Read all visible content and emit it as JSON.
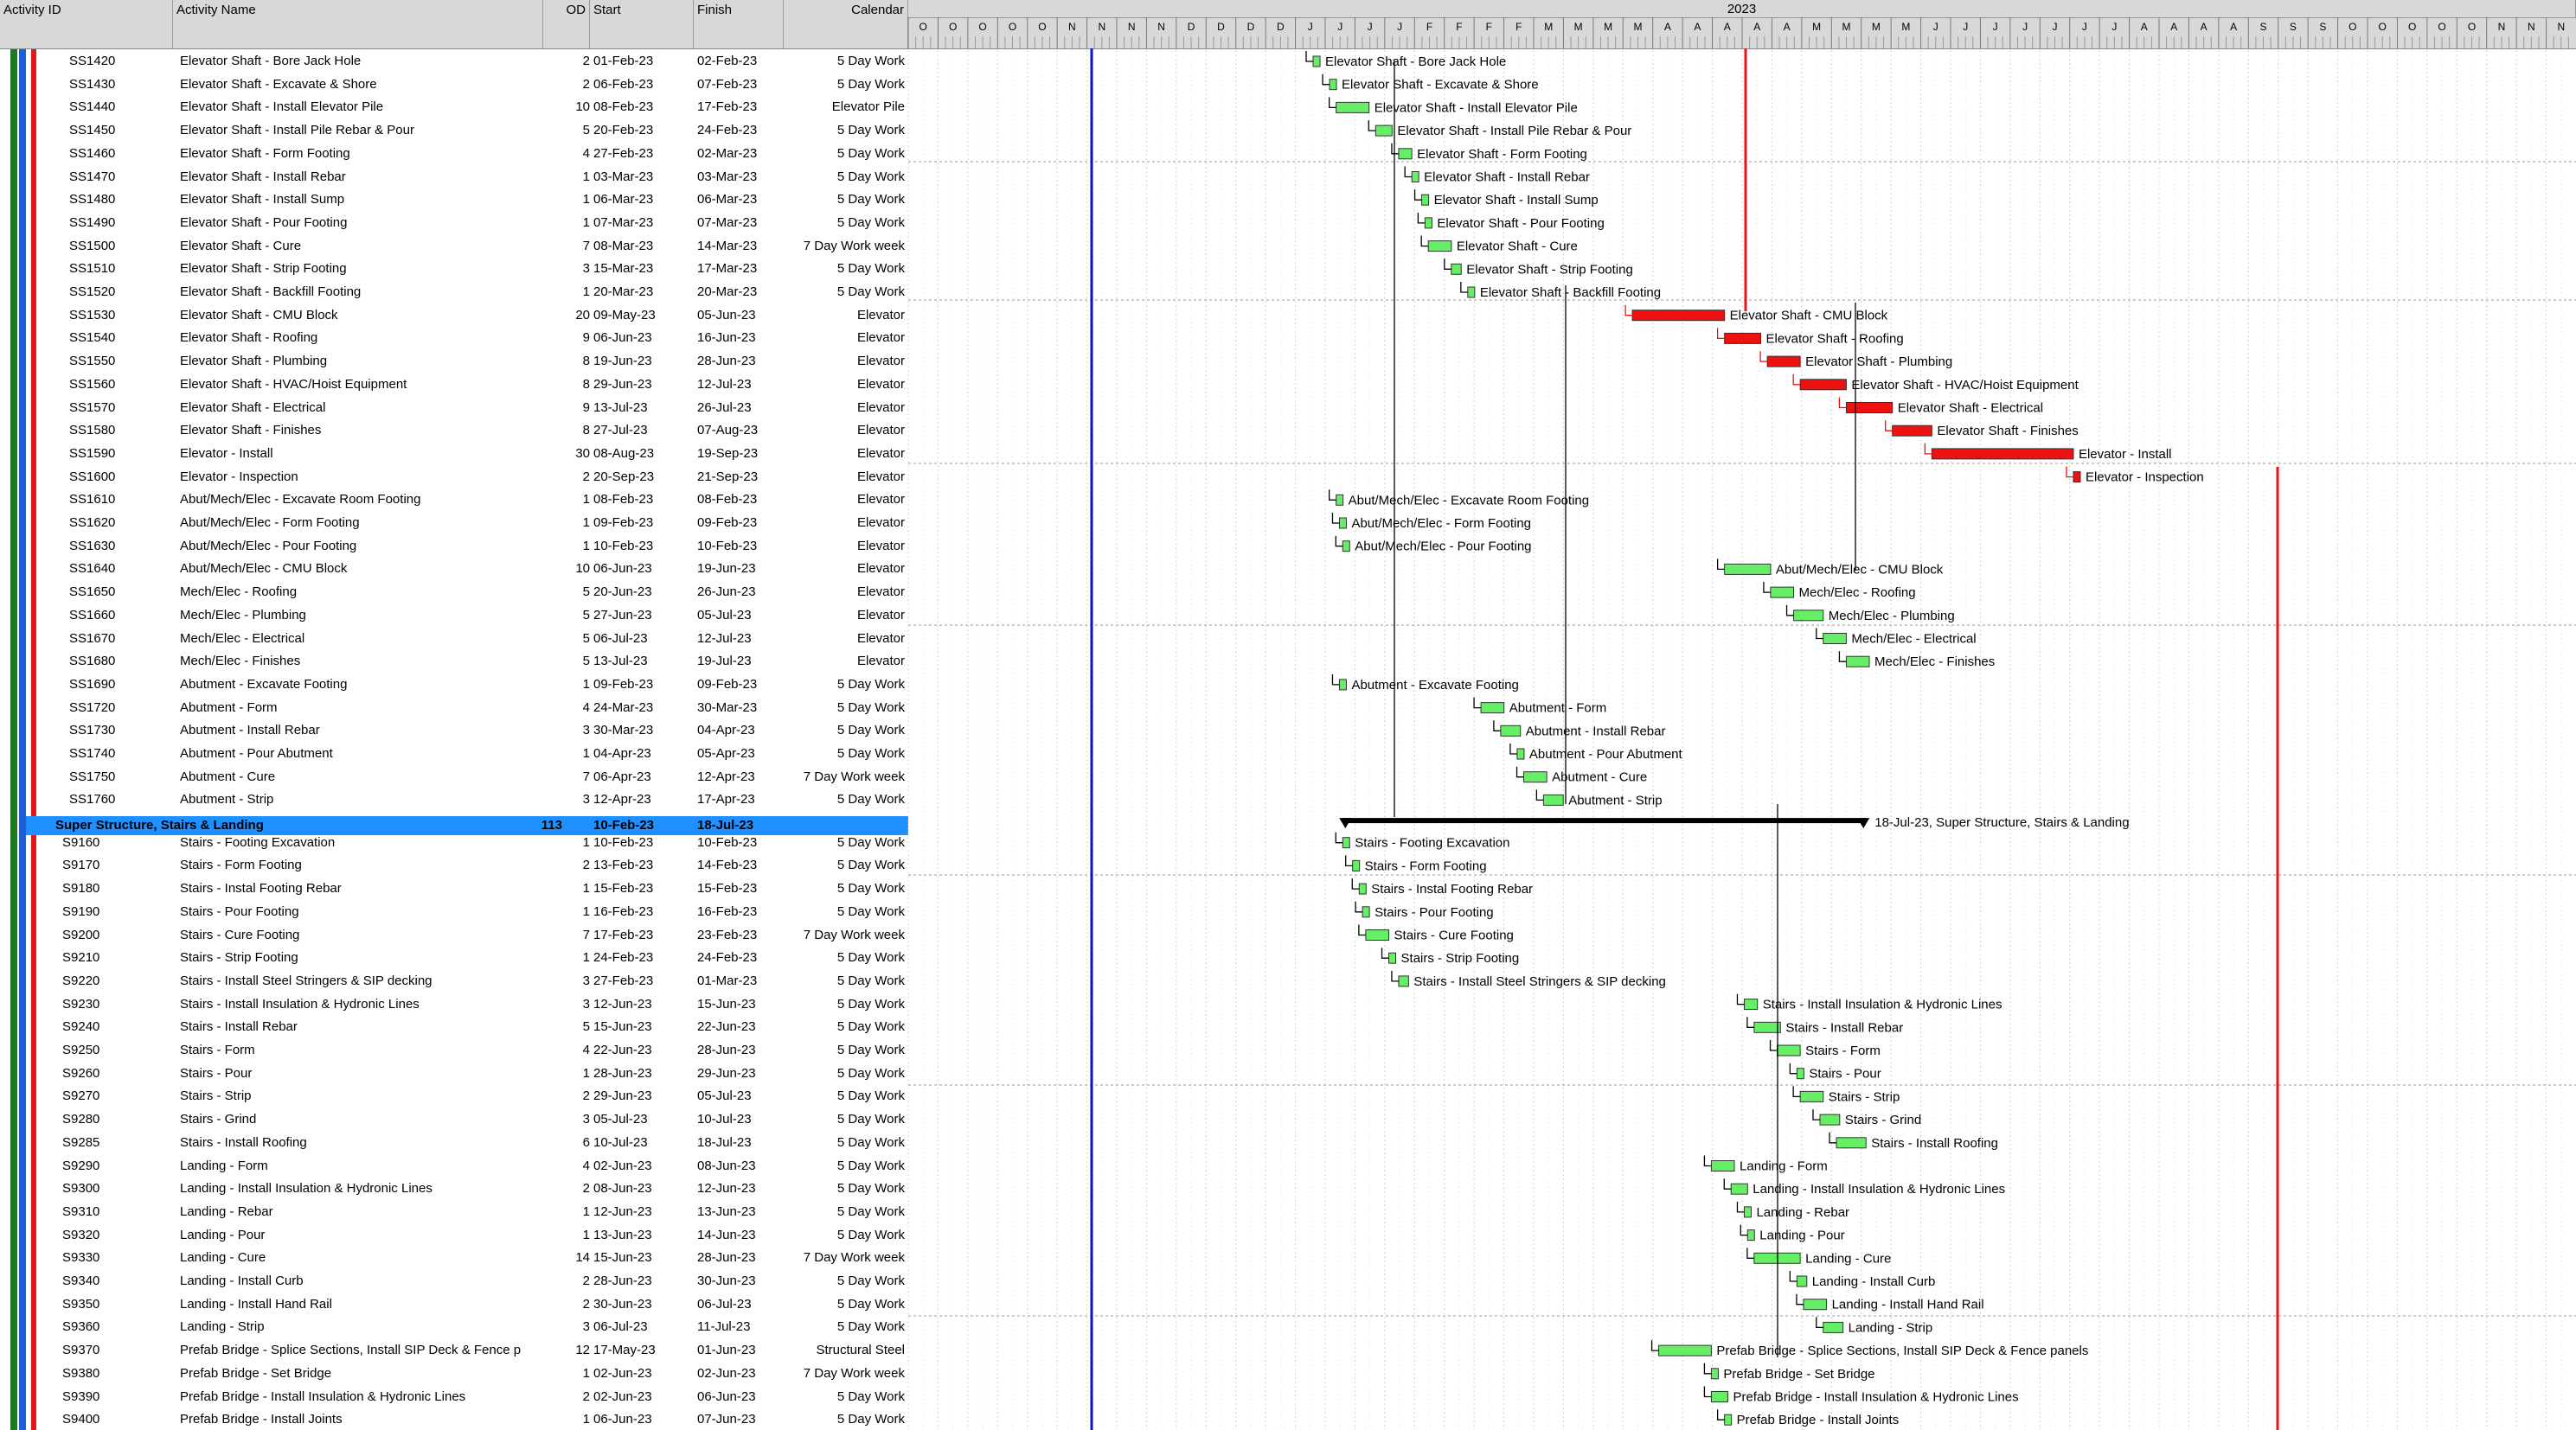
{
  "columns": {
    "id": "Activity ID",
    "name": "Activity Name",
    "od": "OD",
    "start": "Start",
    "finish": "Finish",
    "calendar": "Calendar"
  },
  "timeline": {
    "year": "2023",
    "months": [
      "O",
      "O",
      "O",
      "O",
      "O",
      "N",
      "N",
      "N",
      "N",
      "D",
      "D",
      "D",
      "D",
      "J",
      "J",
      "J",
      "J",
      "F",
      "F",
      "F",
      "F",
      "M",
      "M",
      "M",
      "M",
      "A",
      "A",
      "A",
      "A",
      "A",
      "M",
      "M",
      "M",
      "M",
      "J",
      "J",
      "J",
      "J",
      "J",
      "J",
      "J",
      "A",
      "A",
      "A",
      "A",
      "S",
      "S",
      "S",
      "O",
      "O",
      "O",
      "O",
      "O",
      "N",
      "N",
      "N"
    ]
  },
  "wbs": {
    "name": "Super Structure, Stairs & Landing",
    "od": "113",
    "start": "10-Feb-23",
    "finish": "18-Jul-23",
    "bar_label": "18-Jul-23, Super Structure, Stairs & Landing"
  },
  "colors": {
    "selected": "#1e90ff",
    "critical": "#ee1111",
    "normal": "#66ee66",
    "data_date": "#1010cc",
    "header": "#d8d8d8"
  },
  "activities": [
    {
      "id": "SS1420",
      "name": "Elevator Shaft - Bore Jack Hole",
      "od": "2",
      "start": "01-Feb-23",
      "finish": "02-Feb-23",
      "cal": "5 Day Work"
    },
    {
      "id": "SS1430",
      "name": "Elevator Shaft - Excavate & Shore",
      "od": "2",
      "start": "06-Feb-23",
      "finish": "07-Feb-23",
      "cal": "5 Day Work"
    },
    {
      "id": "SS1440",
      "name": "Elevator Shaft - Install Elevator Pile",
      "od": "10",
      "start": "08-Feb-23",
      "finish": "17-Feb-23",
      "cal": "Elevator Pile"
    },
    {
      "id": "SS1450",
      "name": "Elevator Shaft - Install Pile Rebar & Pour",
      "od": "5",
      "start": "20-Feb-23",
      "finish": "24-Feb-23",
      "cal": "5 Day Work"
    },
    {
      "id": "SS1460",
      "name": "Elevator Shaft - Form Footing",
      "od": "4",
      "start": "27-Feb-23",
      "finish": "02-Mar-23",
      "cal": "5 Day Work"
    },
    {
      "id": "SS1470",
      "name": "Elevator Shaft - Install Rebar",
      "od": "1",
      "start": "03-Mar-23",
      "finish": "03-Mar-23",
      "cal": "5 Day Work"
    },
    {
      "id": "SS1480",
      "name": "Elevator Shaft - Install Sump",
      "od": "1",
      "start": "06-Mar-23",
      "finish": "06-Mar-23",
      "cal": "5 Day Work"
    },
    {
      "id": "SS1490",
      "name": "Elevator Shaft - Pour Footing",
      "od": "1",
      "start": "07-Mar-23",
      "finish": "07-Mar-23",
      "cal": "5 Day Work"
    },
    {
      "id": "SS1500",
      "name": "Elevator Shaft - Cure",
      "od": "7",
      "start": "08-Mar-23",
      "finish": "14-Mar-23",
      "cal": "7 Day Work week"
    },
    {
      "id": "SS1510",
      "name": "Elevator Shaft - Strip Footing",
      "od": "3",
      "start": "15-Mar-23",
      "finish": "17-Mar-23",
      "cal": "5 Day Work"
    },
    {
      "id": "SS1520",
      "name": "Elevator Shaft - Backfill Footing",
      "od": "1",
      "start": "20-Mar-23",
      "finish": "20-Mar-23",
      "cal": "5 Day Work"
    },
    {
      "id": "SS1530",
      "name": "Elevator Shaft - CMU Block",
      "od": "20",
      "start": "09-May-23",
      "finish": "05-Jun-23",
      "cal": "Elevator"
    },
    {
      "id": "SS1540",
      "name": "Elevator Shaft - Roofing",
      "od": "9",
      "start": "06-Jun-23",
      "finish": "16-Jun-23",
      "cal": "Elevator"
    },
    {
      "id": "SS1550",
      "name": "Elevator Shaft - Plumbing",
      "od": "8",
      "start": "19-Jun-23",
      "finish": "28-Jun-23",
      "cal": "Elevator"
    },
    {
      "id": "SS1560",
      "name": "Elevator Shaft - HVAC/Hoist Equipment",
      "od": "8",
      "start": "29-Jun-23",
      "finish": "12-Jul-23",
      "cal": "Elevator"
    },
    {
      "id": "SS1570",
      "name": "Elevator Shaft - Electrical",
      "od": "9",
      "start": "13-Jul-23",
      "finish": "26-Jul-23",
      "cal": "Elevator"
    },
    {
      "id": "SS1580",
      "name": "Elevator Shaft - Finishes",
      "od": "8",
      "start": "27-Jul-23",
      "finish": "07-Aug-23",
      "cal": "Elevator"
    },
    {
      "id": "SS1590",
      "name": "Elevator - Install",
      "od": "30",
      "start": "08-Aug-23",
      "finish": "19-Sep-23",
      "cal": "Elevator"
    },
    {
      "id": "SS1600",
      "name": "Elevator - Inspection",
      "od": "2",
      "start": "20-Sep-23",
      "finish": "21-Sep-23",
      "cal": "Elevator"
    },
    {
      "id": "SS1610",
      "name": "Abut/Mech/Elec - Excavate Room Footing",
      "od": "1",
      "start": "08-Feb-23",
      "finish": "08-Feb-23",
      "cal": "Elevator"
    },
    {
      "id": "SS1620",
      "name": "Abut/Mech/Elec - Form Footing",
      "od": "1",
      "start": "09-Feb-23",
      "finish": "09-Feb-23",
      "cal": "Elevator"
    },
    {
      "id": "SS1630",
      "name": "Abut/Mech/Elec - Pour Footing",
      "od": "1",
      "start": "10-Feb-23",
      "finish": "10-Feb-23",
      "cal": "Elevator"
    },
    {
      "id": "SS1640",
      "name": "Abut/Mech/Elec - CMU Block",
      "od": "10",
      "start": "06-Jun-23",
      "finish": "19-Jun-23",
      "cal": "Elevator"
    },
    {
      "id": "SS1650",
      "name": "Mech/Elec - Roofing",
      "od": "5",
      "start": "20-Jun-23",
      "finish": "26-Jun-23",
      "cal": "Elevator"
    },
    {
      "id": "SS1660",
      "name": "Mech/Elec - Plumbing",
      "od": "5",
      "start": "27-Jun-23",
      "finish": "05-Jul-23",
      "cal": "Elevator"
    },
    {
      "id": "SS1670",
      "name": "Mech/Elec - Electrical",
      "od": "5",
      "start": "06-Jul-23",
      "finish": "12-Jul-23",
      "cal": "Elevator"
    },
    {
      "id": "SS1680",
      "name": "Mech/Elec - Finishes",
      "od": "5",
      "start": "13-Jul-23",
      "finish": "19-Jul-23",
      "cal": "Elevator"
    },
    {
      "id": "SS1690",
      "name": "Abutment - Excavate Footing",
      "od": "1",
      "start": "09-Feb-23",
      "finish": "09-Feb-23",
      "cal": "5 Day Work"
    },
    {
      "id": "SS1720",
      "name": "Abutment - Form",
      "od": "4",
      "start": "24-Mar-23",
      "finish": "30-Mar-23",
      "cal": "5 Day Work"
    },
    {
      "id": "SS1730",
      "name": "Abutment - Install Rebar",
      "od": "3",
      "start": "30-Mar-23",
      "finish": "04-Apr-23",
      "cal": "5 Day Work"
    },
    {
      "id": "SS1740",
      "name": "Abutment - Pour Abutment",
      "od": "1",
      "start": "04-Apr-23",
      "finish": "05-Apr-23",
      "cal": "5 Day Work"
    },
    {
      "id": "SS1750",
      "name": "Abutment - Cure",
      "od": "7",
      "start": "06-Apr-23",
      "finish": "12-Apr-23",
      "cal": "7 Day Work week"
    },
    {
      "id": "SS1760",
      "name": "Abutment - Strip",
      "od": "3",
      "start": "12-Apr-23",
      "finish": "17-Apr-23",
      "cal": "5 Day Work"
    },
    {
      "id": "S9160",
      "name": "Stairs - Footing Excavation",
      "od": "1",
      "start": "10-Feb-23",
      "finish": "10-Feb-23",
      "cal": "5 Day Work"
    },
    {
      "id": "S9170",
      "name": "Stairs - Form Footing",
      "od": "2",
      "start": "13-Feb-23",
      "finish": "14-Feb-23",
      "cal": "5 Day Work"
    },
    {
      "id": "S9180",
      "name": "Stairs - Instal Footing Rebar",
      "od": "1",
      "start": "15-Feb-23",
      "finish": "15-Feb-23",
      "cal": "5 Day Work"
    },
    {
      "id": "S9190",
      "name": "Stairs - Pour Footing",
      "od": "1",
      "start": "16-Feb-23",
      "finish": "16-Feb-23",
      "cal": "5 Day Work"
    },
    {
      "id": "S9200",
      "name": "Stairs - Cure Footing",
      "od": "7",
      "start": "17-Feb-23",
      "finish": "23-Feb-23",
      "cal": "7 Day Work week"
    },
    {
      "id": "S9210",
      "name": "Stairs - Strip Footing",
      "od": "1",
      "start": "24-Feb-23",
      "finish": "24-Feb-23",
      "cal": "5 Day Work"
    },
    {
      "id": "S9220",
      "name": "Stairs - Install Steel Stringers & SIP decking",
      "od": "3",
      "start": "27-Feb-23",
      "finish": "01-Mar-23",
      "cal": "5 Day Work"
    },
    {
      "id": "S9230",
      "name": "Stairs - Install Insulation & Hydronic Lines",
      "od": "3",
      "start": "12-Jun-23",
      "finish": "15-Jun-23",
      "cal": "5 Day Work"
    },
    {
      "id": "S9240",
      "name": "Stairs - Install Rebar",
      "od": "5",
      "start": "15-Jun-23",
      "finish": "22-Jun-23",
      "cal": "5 Day Work"
    },
    {
      "id": "S9250",
      "name": "Stairs - Form",
      "od": "4",
      "start": "22-Jun-23",
      "finish": "28-Jun-23",
      "cal": "5 Day Work"
    },
    {
      "id": "S9260",
      "name": "Stairs - Pour",
      "od": "1",
      "start": "28-Jun-23",
      "finish": "29-Jun-23",
      "cal": "5 Day Work"
    },
    {
      "id": "S9270",
      "name": "Stairs - Strip",
      "od": "2",
      "start": "29-Jun-23",
      "finish": "05-Jul-23",
      "cal": "5 Day Work"
    },
    {
      "id": "S9280",
      "name": "Stairs - Grind",
      "od": "3",
      "start": "05-Jul-23",
      "finish": "10-Jul-23",
      "cal": "5 Day Work"
    },
    {
      "id": "S9285",
      "name": "Stairs - Install Roofing",
      "od": "6",
      "start": "10-Jul-23",
      "finish": "18-Jul-23",
      "cal": "5 Day Work"
    },
    {
      "id": "S9290",
      "name": "Landing - Form",
      "od": "4",
      "start": "02-Jun-23",
      "finish": "08-Jun-23",
      "cal": "5 Day Work"
    },
    {
      "id": "S9300",
      "name": "Landing - Install Insulation & Hydronic Lines",
      "od": "2",
      "start": "08-Jun-23",
      "finish": "12-Jun-23",
      "cal": "5 Day Work"
    },
    {
      "id": "S9310",
      "name": "Landing - Rebar",
      "od": "1",
      "start": "12-Jun-23",
      "finish": "13-Jun-23",
      "cal": "5 Day Work"
    },
    {
      "id": "S9320",
      "name": "Landing - Pour",
      "od": "1",
      "start": "13-Jun-23",
      "finish": "14-Jun-23",
      "cal": "5 Day Work"
    },
    {
      "id": "S9330",
      "name": "Landing - Cure",
      "od": "14",
      "start": "15-Jun-23",
      "finish": "28-Jun-23",
      "cal": "7 Day Work week"
    },
    {
      "id": "S9340",
      "name": "Landing - Install Curb",
      "od": "2",
      "start": "28-Jun-23",
      "finish": "30-Jun-23",
      "cal": "5 Day Work"
    },
    {
      "id": "S9350",
      "name": "Landing - Install Hand Rail",
      "od": "2",
      "start": "30-Jun-23",
      "finish": "06-Jul-23",
      "cal": "5 Day Work"
    },
    {
      "id": "S9360",
      "name": "Landing - Strip",
      "od": "3",
      "start": "06-Jul-23",
      "finish": "11-Jul-23",
      "cal": "5 Day Work"
    },
    {
      "id": "S9370",
      "name": "Prefab Bridge - Splice Sections, Install SIP Deck & Fence p",
      "od": "12",
      "start": "17-May-23",
      "finish": "01-Jun-23",
      "cal": "Structural Steel"
    },
    {
      "id": "S9380",
      "name": "Prefab Bridge - Set Bridge",
      "od": "1",
      "start": "02-Jun-23",
      "finish": "02-Jun-23",
      "cal": "7 Day Work week"
    },
    {
      "id": "S9390",
      "name": "Prefab Bridge - Install Insulation & Hydronic Lines",
      "od": "2",
      "start": "02-Jun-23",
      "finish": "06-Jun-23",
      "cal": "5 Day Work"
    },
    {
      "id": "S9400",
      "name": "Prefab Bridge - Install Joints",
      "od": "1",
      "start": "06-Jun-23",
      "finish": "07-Jun-23",
      "cal": "5 Day Work"
    }
  ],
  "bar_labels": [
    "Elevator Shaft - Bore Jack Hole",
    "Elevator Shaft - Excavate & Shore",
    "Elevator Shaft - Install Elevator Pile",
    "Elevator Shaft - Install Pile Rebar & Pour",
    "Elevator Shaft - Form Footing",
    "Elevator Shaft - Install Rebar",
    "Elevator Shaft - Install Sump",
    "Elevator Shaft - Pour Footing",
    "Elevator Shaft - Cure",
    "Elevator Shaft - Strip Footing",
    "Elevator Shaft - Backfill Footing",
    "Elevator Shaft - CMU Block",
    "Elevator Shaft - Roofing",
    "Elevator Shaft - Plumbing",
    "Elevator Shaft - HVAC/Hoist Equipment",
    "Elevator Shaft - Electrical",
    "Elevator Shaft - Finishes",
    "Elevator - Install",
    "Elevator - Inspection",
    "Abut/Mech/Elec - Excavate Room Footing",
    "Abut/Mech/Elec - Form Footing",
    "Abut/Mech/Elec - Pour Footing",
    "Abut/Mech/Elec - CMU Block",
    "Mech/Elec - Roofing",
    "Mech/Elec - Plumbing",
    "Mech/Elec - Electrical",
    "Mech/Elec - Finishes",
    "Abutment - Excavate Footing",
    "Abutment - Form",
    "Abutment - Install Rebar",
    "Abutment - Pour Abutment",
    "Abutment - Cure",
    "Abutment - Strip",
    "Stairs - Footing Excavation",
    "Stairs - Form Footing",
    "Stairs - Instal Footing Rebar",
    "Stairs - Pour Footing",
    "Stairs - Cure Footing",
    "Stairs - Strip Footing",
    "Stairs - Install Steel Stringers & SIP decking",
    "Stairs - Install Insulation & Hydronic Lines",
    "Stairs - Install Rebar",
    "Stairs - Form",
    "Stairs - Pour",
    "Stairs - Strip",
    "Stairs - Grind",
    "Stairs - Install Roofing",
    "Landing - Form",
    "Landing - Install Insulation & Hydronic Lines",
    "Landing - Rebar",
    "Landing - Pour",
    "Landing - Cure",
    "Landing - Install Curb",
    "Landing - Install Hand Rail",
    "Landing - Strip",
    "Prefab Bridge - Splice Sections, Install SIP Deck & Fence panels",
    "Prefab Bridge - Set Bridge",
    "Prefab Bridge - Install Insulation & Hydronic Lines",
    "Prefab Bridge - Install Joints"
  ]
}
